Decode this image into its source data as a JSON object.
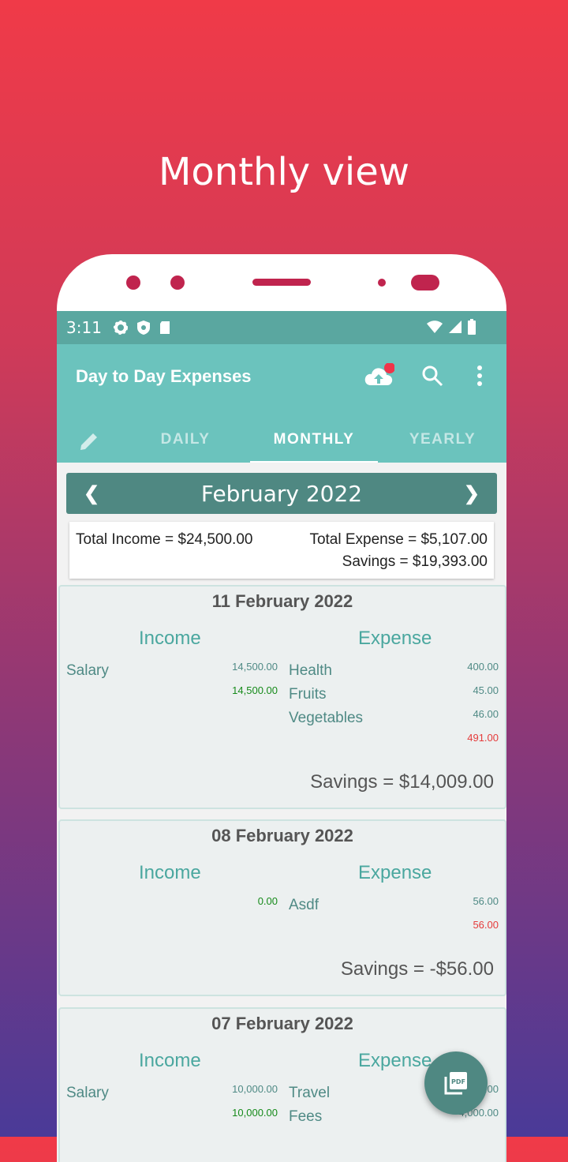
{
  "promo": {
    "headline": "Monthly view"
  },
  "status": {
    "time": "3:11"
  },
  "appbar": {
    "title": "Day to Day Expenses"
  },
  "tabs": [
    {
      "label": "DAILY",
      "active": false
    },
    {
      "label": "MONTHLY",
      "active": true
    },
    {
      "label": "YEARLY",
      "active": false
    }
  ],
  "month": {
    "label": "February 2022"
  },
  "summary": {
    "total_income": "Total Income = $24,500.00",
    "total_expense": "Total Expense = $5,107.00",
    "savings": "Savings = $19,393.00"
  },
  "cards": [
    {
      "date": "11 February 2022",
      "income_header": "Income",
      "expense_header": "Expense",
      "income_items": [
        {
          "name": "Salary",
          "amount": "14,500.00"
        }
      ],
      "income_total": "14,500.00",
      "expense_items": [
        {
          "name": "Health",
          "amount": "400.00"
        },
        {
          "name": "Fruits",
          "amount": "45.00"
        },
        {
          "name": "Vegetables",
          "amount": "46.00"
        }
      ],
      "expense_total": "491.00",
      "savings": "Savings = $14,009.00"
    },
    {
      "date": "08 February 2022",
      "income_header": "Income",
      "expense_header": "Expense",
      "income_items": [],
      "income_total": "0.00",
      "expense_items": [
        {
          "name": "Asdf",
          "amount": "56.00"
        }
      ],
      "expense_total": "56.00",
      "savings": "Savings = -$56.00"
    },
    {
      "date": "07 February 2022",
      "income_header": "Income",
      "expense_header": "Expense",
      "income_items": [
        {
          "name": "Salary",
          "amount": "10,000.00"
        }
      ],
      "income_total": "10,000.00",
      "expense_items": [
        {
          "name": "Travel",
          "amount": "00.00"
        },
        {
          "name": "Fees",
          "amount": "4,000.00"
        }
      ]
    }
  ],
  "fab": {
    "label": "PDF"
  },
  "colors": {
    "primary": "#6bc3bd",
    "dark": "#4f8882",
    "income_total": "#168a1a",
    "expense_total": "#e53b3b"
  }
}
